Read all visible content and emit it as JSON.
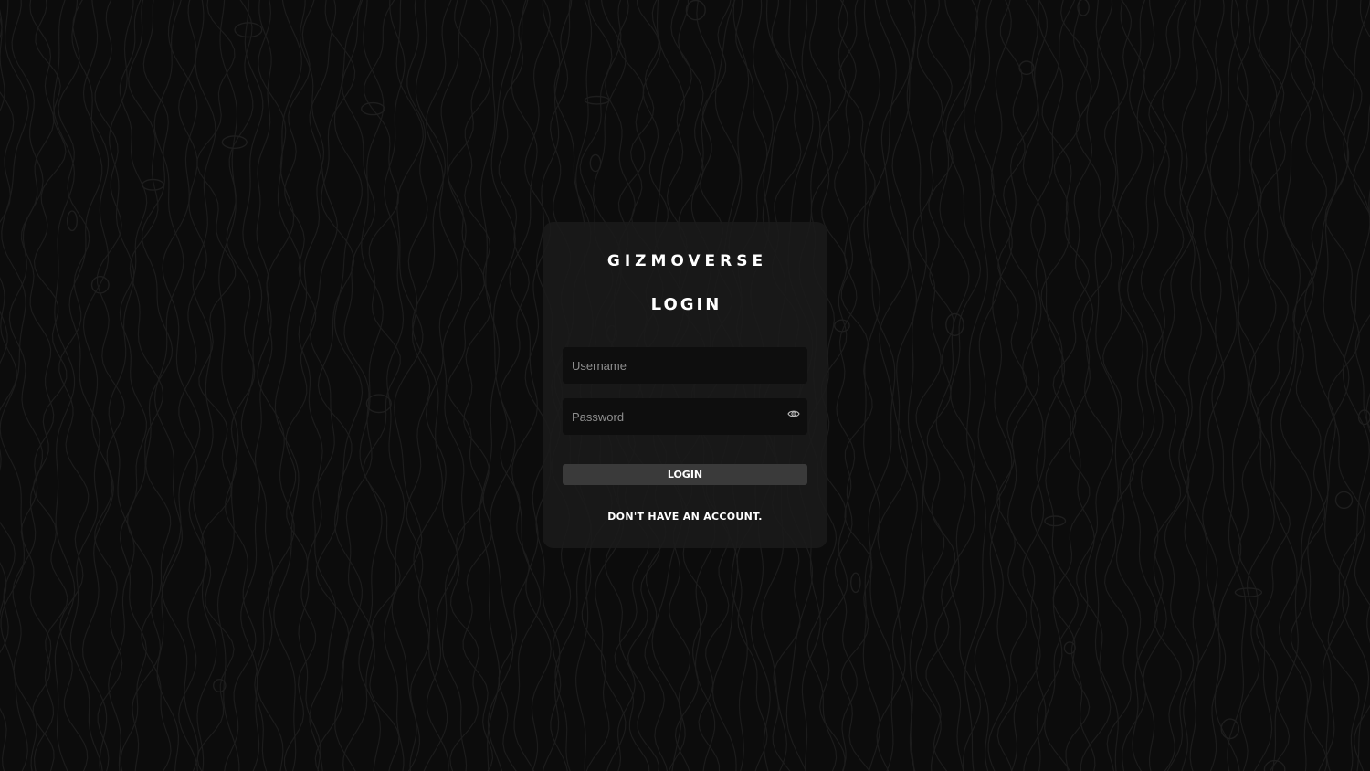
{
  "app": {
    "brand": "GIZMOVERSE"
  },
  "login_form": {
    "heading": "LOGIN",
    "username_placeholder": "Username",
    "username_value": "",
    "password_placeholder": "Password",
    "password_value": "",
    "show_password_icon": "eye-icon",
    "submit_label": "LOGIN",
    "signup_link_label": "DON'T HAVE AN ACCOUNT."
  },
  "theme": {
    "background": "#0c0c0c",
    "card": "#1a1a1a",
    "input": "#0e0e0e",
    "button": "#3a3a3a",
    "text": "#ffffff",
    "placeholder": "#8e8e8e",
    "pattern_lines": "#1c1c1c"
  }
}
